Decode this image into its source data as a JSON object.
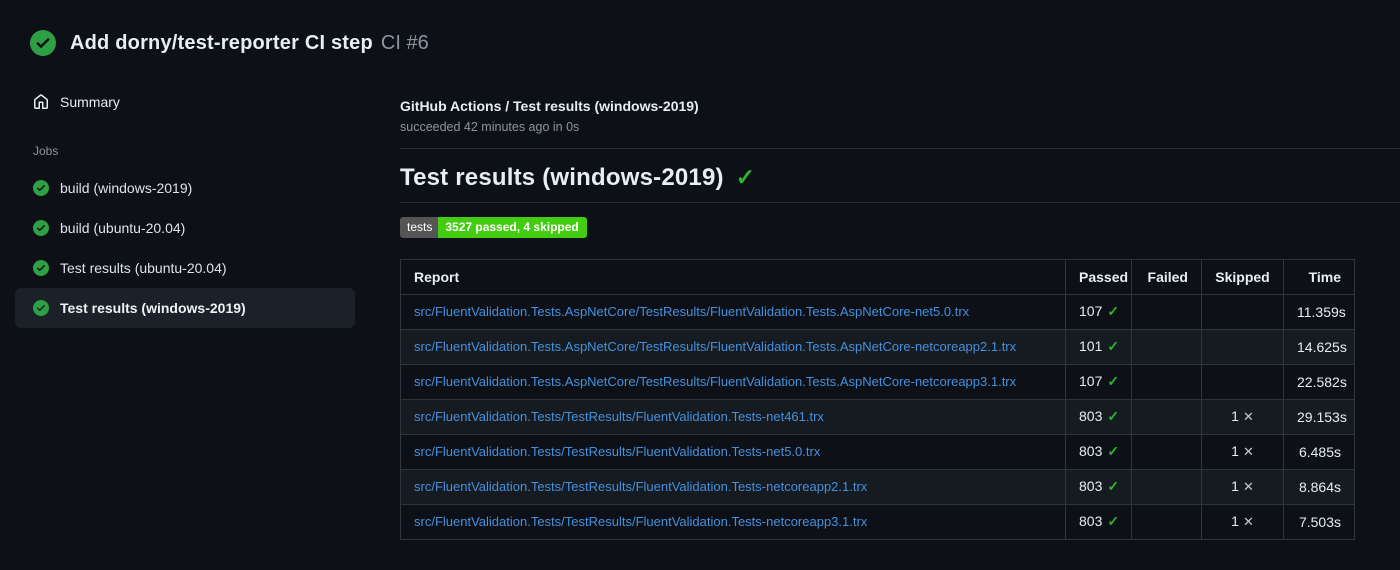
{
  "window": {
    "title": "Add dorny/test-reporter CI step",
    "run_number": "CI #6"
  },
  "sidebar": {
    "summary_label": "Summary",
    "jobs_heading": "Jobs",
    "jobs": [
      {
        "label": "build (windows-2019)",
        "status": "success",
        "selected": false
      },
      {
        "label": "build (ubuntu-20.04)",
        "status": "success",
        "selected": false
      },
      {
        "label": "Test results (ubuntu-20.04)",
        "status": "success",
        "selected": false
      },
      {
        "label": "Test results (windows-2019)",
        "status": "success",
        "selected": true
      }
    ]
  },
  "main": {
    "check_run_title": "GitHub Actions / Test results (windows-2019)",
    "check_run_status": "succeeded 42 minutes ago in 0s",
    "report_heading": "Test results (windows-2019)",
    "heading_check_glyph": "✓",
    "badge": {
      "label": "tests",
      "value": "3527 passed, 4 skipped"
    },
    "table": {
      "columns": [
        "Report",
        "Passed",
        "Failed",
        "Skipped",
        "Time"
      ],
      "rows": [
        {
          "report": "src/FluentValidation.Tests.AspNetCore/TestResults/FluentValidation.Tests.AspNetCore-net5.0.trx",
          "passed": "107",
          "failed": "",
          "skipped": "",
          "time": "11.359s"
        },
        {
          "report": "src/FluentValidation.Tests.AspNetCore/TestResults/FluentValidation.Tests.AspNetCore-netcoreapp2.1.trx",
          "passed": "101",
          "failed": "",
          "skipped": "",
          "time": "14.625s"
        },
        {
          "report": "src/FluentValidation.Tests.AspNetCore/TestResults/FluentValidation.Tests.AspNetCore-netcoreapp3.1.trx",
          "passed": "107",
          "failed": "",
          "skipped": "",
          "time": "22.582s"
        },
        {
          "report": "src/FluentValidation.Tests/TestResults/FluentValidation.Tests-net461.trx",
          "passed": "803",
          "failed": "",
          "skipped": "1",
          "time": "29.153s"
        },
        {
          "report": "src/FluentValidation.Tests/TestResults/FluentValidation.Tests-net5.0.trx",
          "passed": "803",
          "failed": "",
          "skipped": "1",
          "time": "6.485s"
        },
        {
          "report": "src/FluentValidation.Tests/TestResults/FluentValidation.Tests-netcoreapp2.1.trx",
          "passed": "803",
          "failed": "",
          "skipped": "1",
          "time": "8.864s"
        },
        {
          "report": "src/FluentValidation.Tests/TestResults/FluentValidation.Tests-netcoreapp3.1.trx",
          "passed": "803",
          "failed": "",
          "skipped": "1",
          "time": "7.503s"
        }
      ]
    }
  },
  "glyphs": {
    "passed_check": "✓",
    "skipped_x": "✕"
  },
  "colors": {
    "background": "#0d1117",
    "row_alt_background": "#161b22",
    "table_border": "#30363d",
    "text_primary": "#e6edf3",
    "text_secondary": "#8b949e",
    "link_blue": "#4590dc",
    "success_circle_green": "#2ea043",
    "check_green": "#2fb22f",
    "badge_label_bg": "#555555",
    "badge_value_bg": "#44cc11",
    "selected_item_bg": "#1b2129"
  }
}
